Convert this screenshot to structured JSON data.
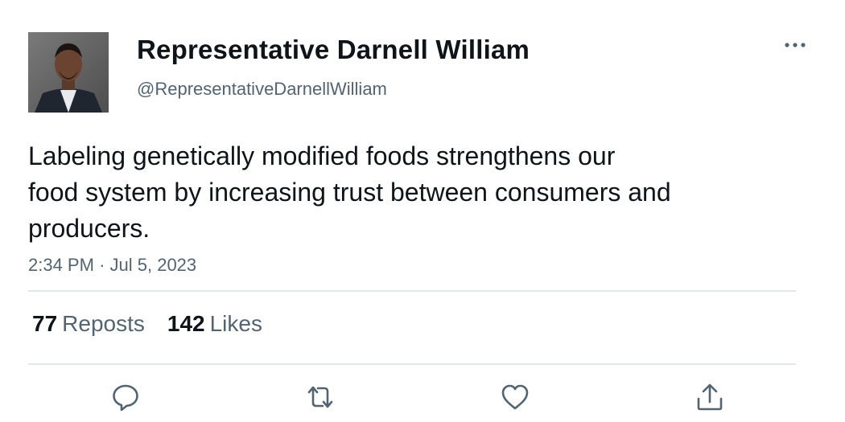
{
  "author": {
    "display_name": "Representative Darnell William",
    "handle": "@RepresentativeDarnellWilliam"
  },
  "tweet": {
    "text_lines": [
      "Labeling genetically modified foods strengthens our",
      "food system by increasing trust between consumers and",
      "producers."
    ],
    "time": "2:34 PM",
    "separator": "·",
    "date": "Jul 5, 2023"
  },
  "stats": {
    "reposts_count": "77",
    "reposts_label": "Reposts",
    "likes_count": "142",
    "likes_label": "Likes"
  },
  "icons": {
    "more": "more-horizontal-icon",
    "reply": "reply-icon",
    "repost": "repost-icon",
    "like": "heart-icon",
    "share": "share-icon"
  },
  "colors": {
    "text_primary": "#0f1419",
    "text_secondary": "#536471",
    "divider": "#e3e6e8",
    "icon": "#536471"
  }
}
